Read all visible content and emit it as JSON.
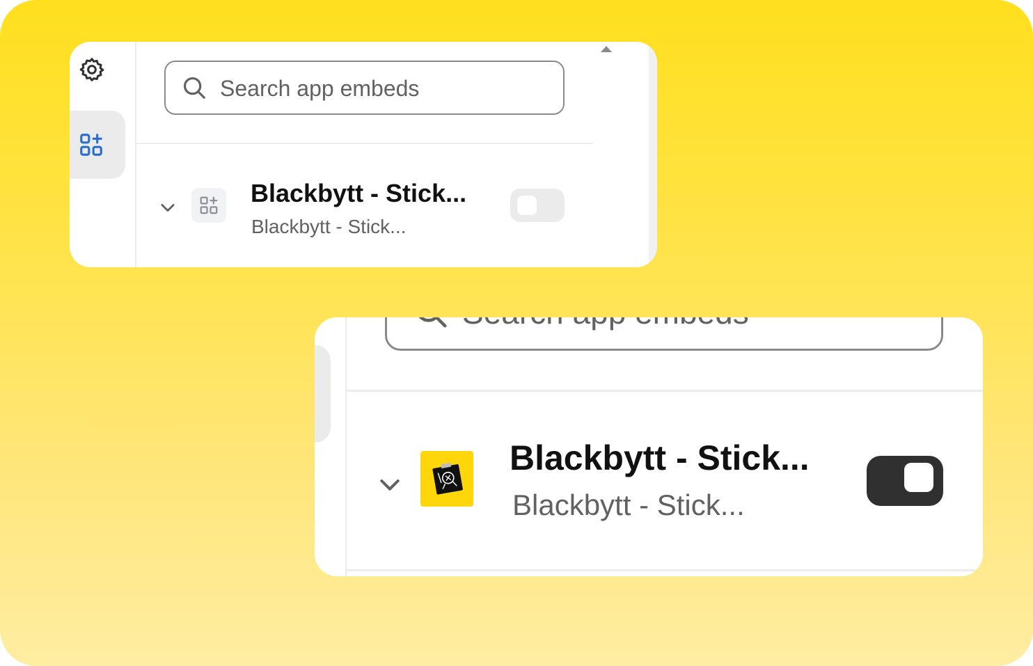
{
  "colors": {
    "accent_blue": "#2C6ECB",
    "background_top": "#FFDF1E",
    "background_bottom": "#FFEDA2",
    "toggle_on": "#303030",
    "toggle_off": "#EBEBEB",
    "app_icon_bg": "#FFD60A"
  },
  "card_zoomed_out": {
    "sidebar": {
      "items": [
        {
          "name": "settings",
          "icon": "gear-icon",
          "active": false
        },
        {
          "name": "app-embeds",
          "icon": "apps-add-icon",
          "active": true
        }
      ]
    },
    "search": {
      "placeholder": "Search app embeds"
    },
    "embed": {
      "title": "Blackbytt - Stick...",
      "subtitle": "Blackbytt - Stick...",
      "enabled": false
    }
  },
  "card_zoomed_in": {
    "search": {
      "placeholder": "Search app embeds"
    },
    "embed": {
      "title": "Blackbytt - Stick...",
      "subtitle": "Blackbytt - Stick...",
      "enabled": true
    }
  }
}
